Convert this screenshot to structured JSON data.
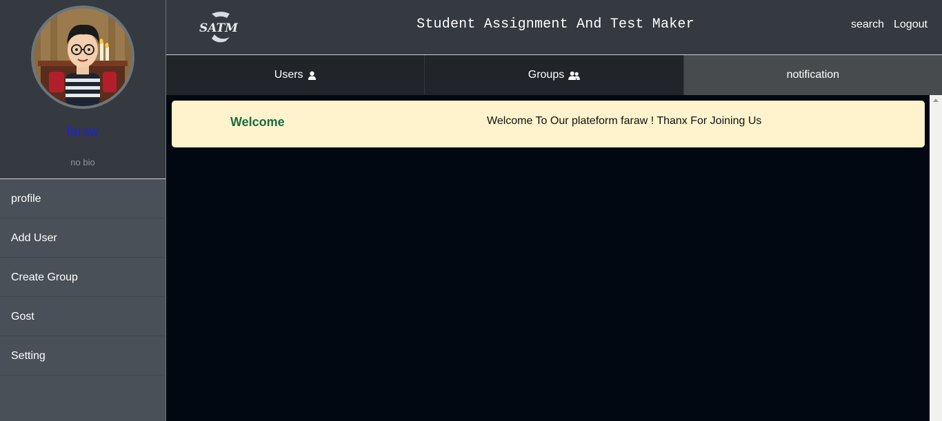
{
  "sidebar": {
    "username": "faraw",
    "bio": "no bio",
    "items": [
      {
        "label": "profile"
      },
      {
        "label": "Add User"
      },
      {
        "label": "Create Group"
      },
      {
        "label": "Gost"
      },
      {
        "label": "Setting"
      }
    ]
  },
  "header": {
    "logo_text": "SATM",
    "title": "Student Assignment And Test Maker",
    "search_label": "search",
    "logout_label": "Logout"
  },
  "tabs": [
    {
      "label": "Users",
      "icon": "user-icon"
    },
    {
      "label": "Groups",
      "icon": "users-icon"
    },
    {
      "label": "notification",
      "active": true
    }
  ],
  "notifications": [
    {
      "title": "Welcome",
      "message": "Welcome To Our plateform faraw ! Thanx For Joining Us"
    }
  ],
  "colors": {
    "username": "#1f1fe6",
    "notif_bg": "#fff3cd",
    "notif_title": "#1a6b40",
    "content_bg": "#010812"
  }
}
